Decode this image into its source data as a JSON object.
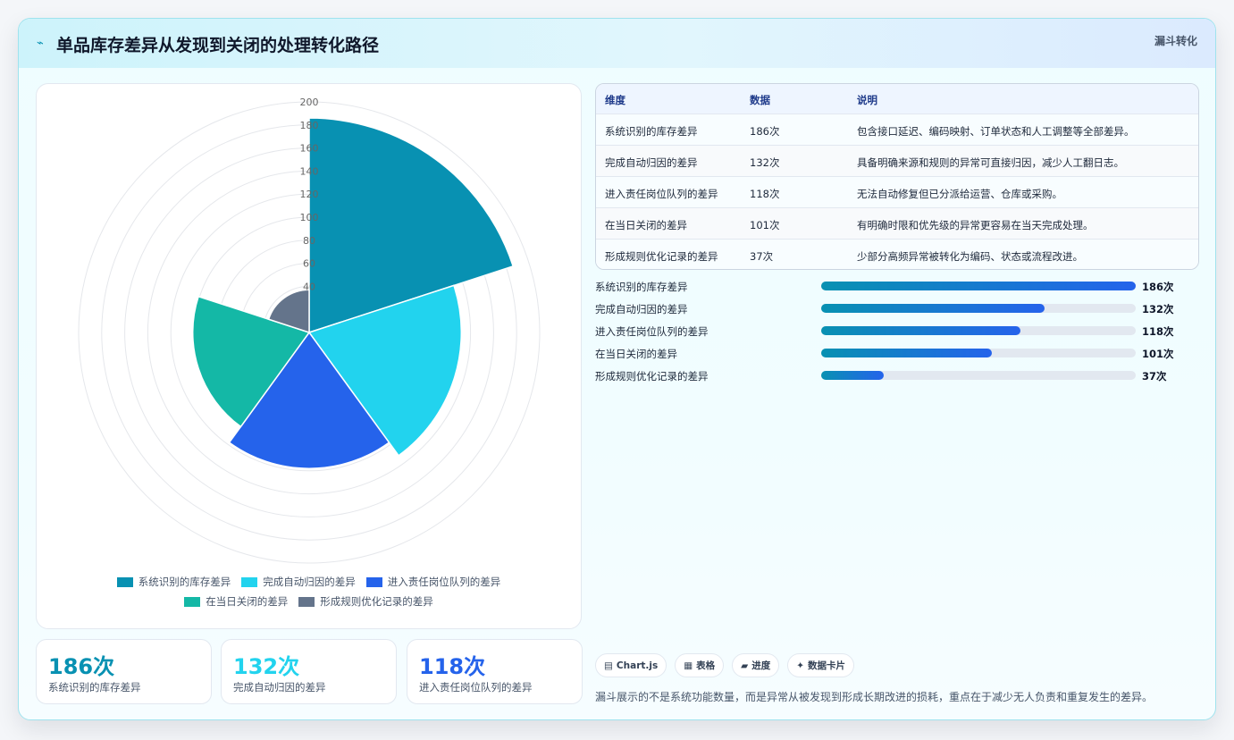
{
  "header": {
    "title_icon": "funnel-icon",
    "title": "单品库存差异从发现到关闭的处理转化路径",
    "badge": "漏斗转化"
  },
  "colors": {
    "accent": "#0891b2",
    "series": [
      "#0891b2",
      "#22d3ee",
      "#2563eb",
      "#14b8a6",
      "#64748b"
    ]
  },
  "chart_data": {
    "type": "polarArea",
    "categories": [
      "系统识别的库存差异",
      "完成自动归因的差异",
      "进入责任岗位队列的差异",
      "在当日关闭的差异",
      "形成规则优化记录的差异"
    ],
    "values": [
      186,
      132,
      118,
      101,
      37
    ],
    "r_ticks": [
      "40",
      "60",
      "80",
      "100",
      "120",
      "140",
      "160",
      "180",
      "200"
    ],
    "r_tick_values": [
      40,
      60,
      80,
      100,
      120,
      140,
      160,
      180,
      200
    ],
    "rlim": [
      0,
      200
    ],
    "grid": true,
    "legend_position": "bottom"
  },
  "stats": [
    {
      "value": "186次",
      "label": "系统识别的库存差异"
    },
    {
      "value": "132次",
      "label": "完成自动归因的差异"
    },
    {
      "value": "118次",
      "label": "进入责任岗位队列的差异"
    }
  ],
  "table": {
    "headers": [
      "维度",
      "数据",
      "说明"
    ],
    "rows": [
      [
        "系统识别的库存差异",
        "186次",
        "包含接口延迟、编码映射、订单状态和人工调整等全部差异。"
      ],
      [
        "完成自动归因的差异",
        "132次",
        "具备明确来源和规则的异常可直接归因，减少人工翻日志。"
      ],
      [
        "进入责任岗位队列的差异",
        "118次",
        "无法自动修复但已分派给运营、仓库或采购。"
      ],
      [
        "在当日关闭的差异",
        "101次",
        "有明确时限和优先级的异常更容易在当天完成处理。"
      ],
      [
        "形成规则优化记录的差异",
        "37次",
        "少部分高频异常被转化为编码、状态或流程改进。"
      ]
    ]
  },
  "bars": [
    {
      "label": "系统识别的库存差异",
      "value": "186次",
      "fraction": 1.0
    },
    {
      "label": "完成自动归因的差异",
      "value": "132次",
      "fraction": 0.7097
    },
    {
      "label": "进入责任岗位队列的差异",
      "value": "118次",
      "fraction": 0.6344
    },
    {
      "label": "在当日关闭的差异",
      "value": "101次",
      "fraction": 0.543
    },
    {
      "label": "形成规则优化记录的差异",
      "value": "37次",
      "fraction": 0.1989
    }
  ],
  "tags": [
    {
      "icon": "▤",
      "label": "Chart.js"
    },
    {
      "icon": "▦",
      "label": "表格"
    },
    {
      "icon": "▰",
      "label": "进度"
    },
    {
      "icon": "✦",
      "label": "数据卡片"
    }
  ],
  "footer": "漏斗展示的不是系统功能数量，而是异常从被发现到形成长期改进的损耗，重点在于减少无人负责和重复发生的差异。"
}
